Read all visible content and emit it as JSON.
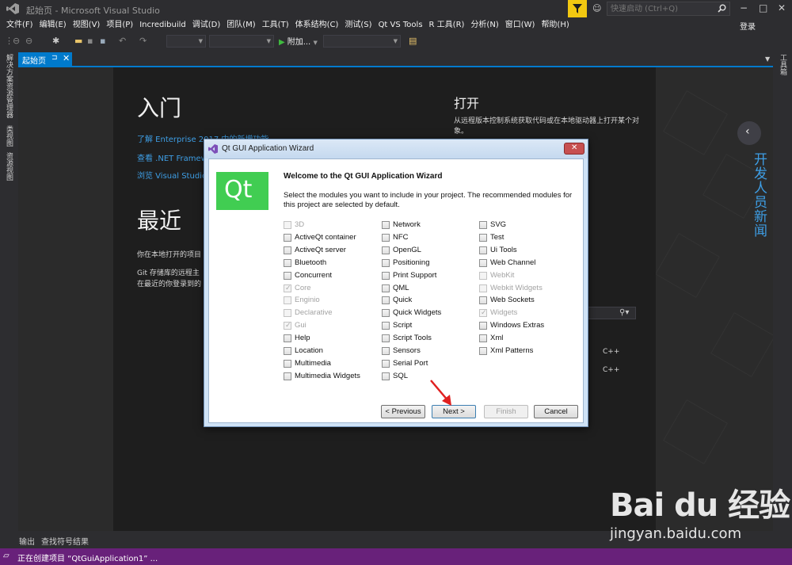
{
  "window": {
    "title": "起始页 - Microsoft Visual Studio",
    "quick_launch_placeholder": "快速启动 (Ctrl+Q)"
  },
  "menu": {
    "items": [
      "文件(F)",
      "编辑(E)",
      "视图(V)",
      "项目(P)",
      "Incredibuild",
      "调试(D)",
      "团队(M)",
      "工具(T)",
      "体系结构(C)",
      "测试(S)",
      "Qt VS Tools",
      "R 工具(R)",
      "分析(N)",
      "窗口(W)",
      "帮助(H)"
    ],
    "login": "登录"
  },
  "toolbar": {
    "run_label": "附加..."
  },
  "left_strip": {
    "items": [
      "解决方案资源管理器",
      "类视图",
      "资源视图"
    ]
  },
  "right_strip": {
    "items": [
      "工具箱"
    ]
  },
  "doc_tab": {
    "label": "起始页",
    "pin": "⊐",
    "close": "✕"
  },
  "start_page": {
    "start_heading": "入门",
    "links": [
      "了解 Enterprise 2017 中的新增功能",
      "查看 .NET Framew",
      "浏览 Visual Studio"
    ],
    "recent_heading": "最近",
    "recent_text": "你在本地打开的项目",
    "git_text_1": "Git 存储库的远程主",
    "git_text_2": "在最近的你登录到的",
    "open_heading": "打开",
    "open_desc": "从远程版本控制系统获取代码或在本地驱动器上打开某个对象。",
    "cpp_labels": [
      "C++",
      "C++"
    ],
    "news_heading": "开发人员新闻"
  },
  "output_tabs": [
    "输出",
    "查找符号结果"
  ],
  "status": {
    "text": "正在创建项目 “QtGuiApplication1” ..."
  },
  "watermark": {
    "logo": "Bai du 经验",
    "url": "jingyan.baidu.com"
  },
  "wizard": {
    "title": "Qt GUI Application Wizard",
    "logo_text": "Qt",
    "heading": "Welcome to the Qt GUI Application Wizard",
    "description": "Select the modules you want to include in your project. The recommended modules for this project are selected by default.",
    "modules_col1": [
      {
        "label": "3D",
        "disabled": true,
        "checked": false
      },
      {
        "label": "ActiveQt container",
        "disabled": false,
        "checked": false
      },
      {
        "label": "ActiveQt server",
        "disabled": false,
        "checked": false
      },
      {
        "label": "Bluetooth",
        "disabled": false,
        "checked": false
      },
      {
        "label": "Concurrent",
        "disabled": false,
        "checked": false
      },
      {
        "label": "Core",
        "disabled": true,
        "checked": true
      },
      {
        "label": "Enginio",
        "disabled": true,
        "checked": false
      },
      {
        "label": "Declarative",
        "disabled": true,
        "checked": false
      },
      {
        "label": "Gui",
        "disabled": true,
        "checked": true
      },
      {
        "label": "Help",
        "disabled": false,
        "checked": false
      },
      {
        "label": "Location",
        "disabled": false,
        "checked": false
      },
      {
        "label": "Multimedia",
        "disabled": false,
        "checked": false
      },
      {
        "label": "Multimedia Widgets",
        "disabled": false,
        "checked": false
      }
    ],
    "modules_col2": [
      {
        "label": "Network",
        "disabled": false,
        "checked": false
      },
      {
        "label": "NFC",
        "disabled": false,
        "checked": false
      },
      {
        "label": "OpenGL",
        "disabled": false,
        "checked": false
      },
      {
        "label": "Positioning",
        "disabled": false,
        "checked": false
      },
      {
        "label": "Print Support",
        "disabled": false,
        "checked": false
      },
      {
        "label": "QML",
        "disabled": false,
        "checked": false
      },
      {
        "label": "Quick",
        "disabled": false,
        "checked": false
      },
      {
        "label": "Quick Widgets",
        "disabled": false,
        "checked": false
      },
      {
        "label": "Script",
        "disabled": false,
        "checked": false
      },
      {
        "label": "Script Tools",
        "disabled": false,
        "checked": false
      },
      {
        "label": "Sensors",
        "disabled": false,
        "checked": false
      },
      {
        "label": "Serial Port",
        "disabled": false,
        "checked": false
      },
      {
        "label": "SQL",
        "disabled": false,
        "checked": false
      }
    ],
    "modules_col3": [
      {
        "label": "SVG",
        "disabled": false,
        "checked": false
      },
      {
        "label": "Test",
        "disabled": false,
        "checked": false
      },
      {
        "label": "Ui Tools",
        "disabled": false,
        "checked": false
      },
      {
        "label": "Web Channel",
        "disabled": false,
        "checked": false
      },
      {
        "label": "WebKit",
        "disabled": true,
        "checked": false
      },
      {
        "label": "Webkit Widgets",
        "disabled": true,
        "checked": false
      },
      {
        "label": "Web Sockets",
        "disabled": false,
        "checked": false
      },
      {
        "label": "Widgets",
        "disabled": true,
        "checked": true
      },
      {
        "label": "Windows Extras",
        "disabled": false,
        "checked": false
      },
      {
        "label": "Xml",
        "disabled": false,
        "checked": false
      },
      {
        "label": "Xml Patterns",
        "disabled": false,
        "checked": false
      }
    ],
    "buttons": {
      "previous": "< Previous",
      "next": "Next >",
      "finish": "Finish",
      "cancel": "Cancel"
    }
  }
}
